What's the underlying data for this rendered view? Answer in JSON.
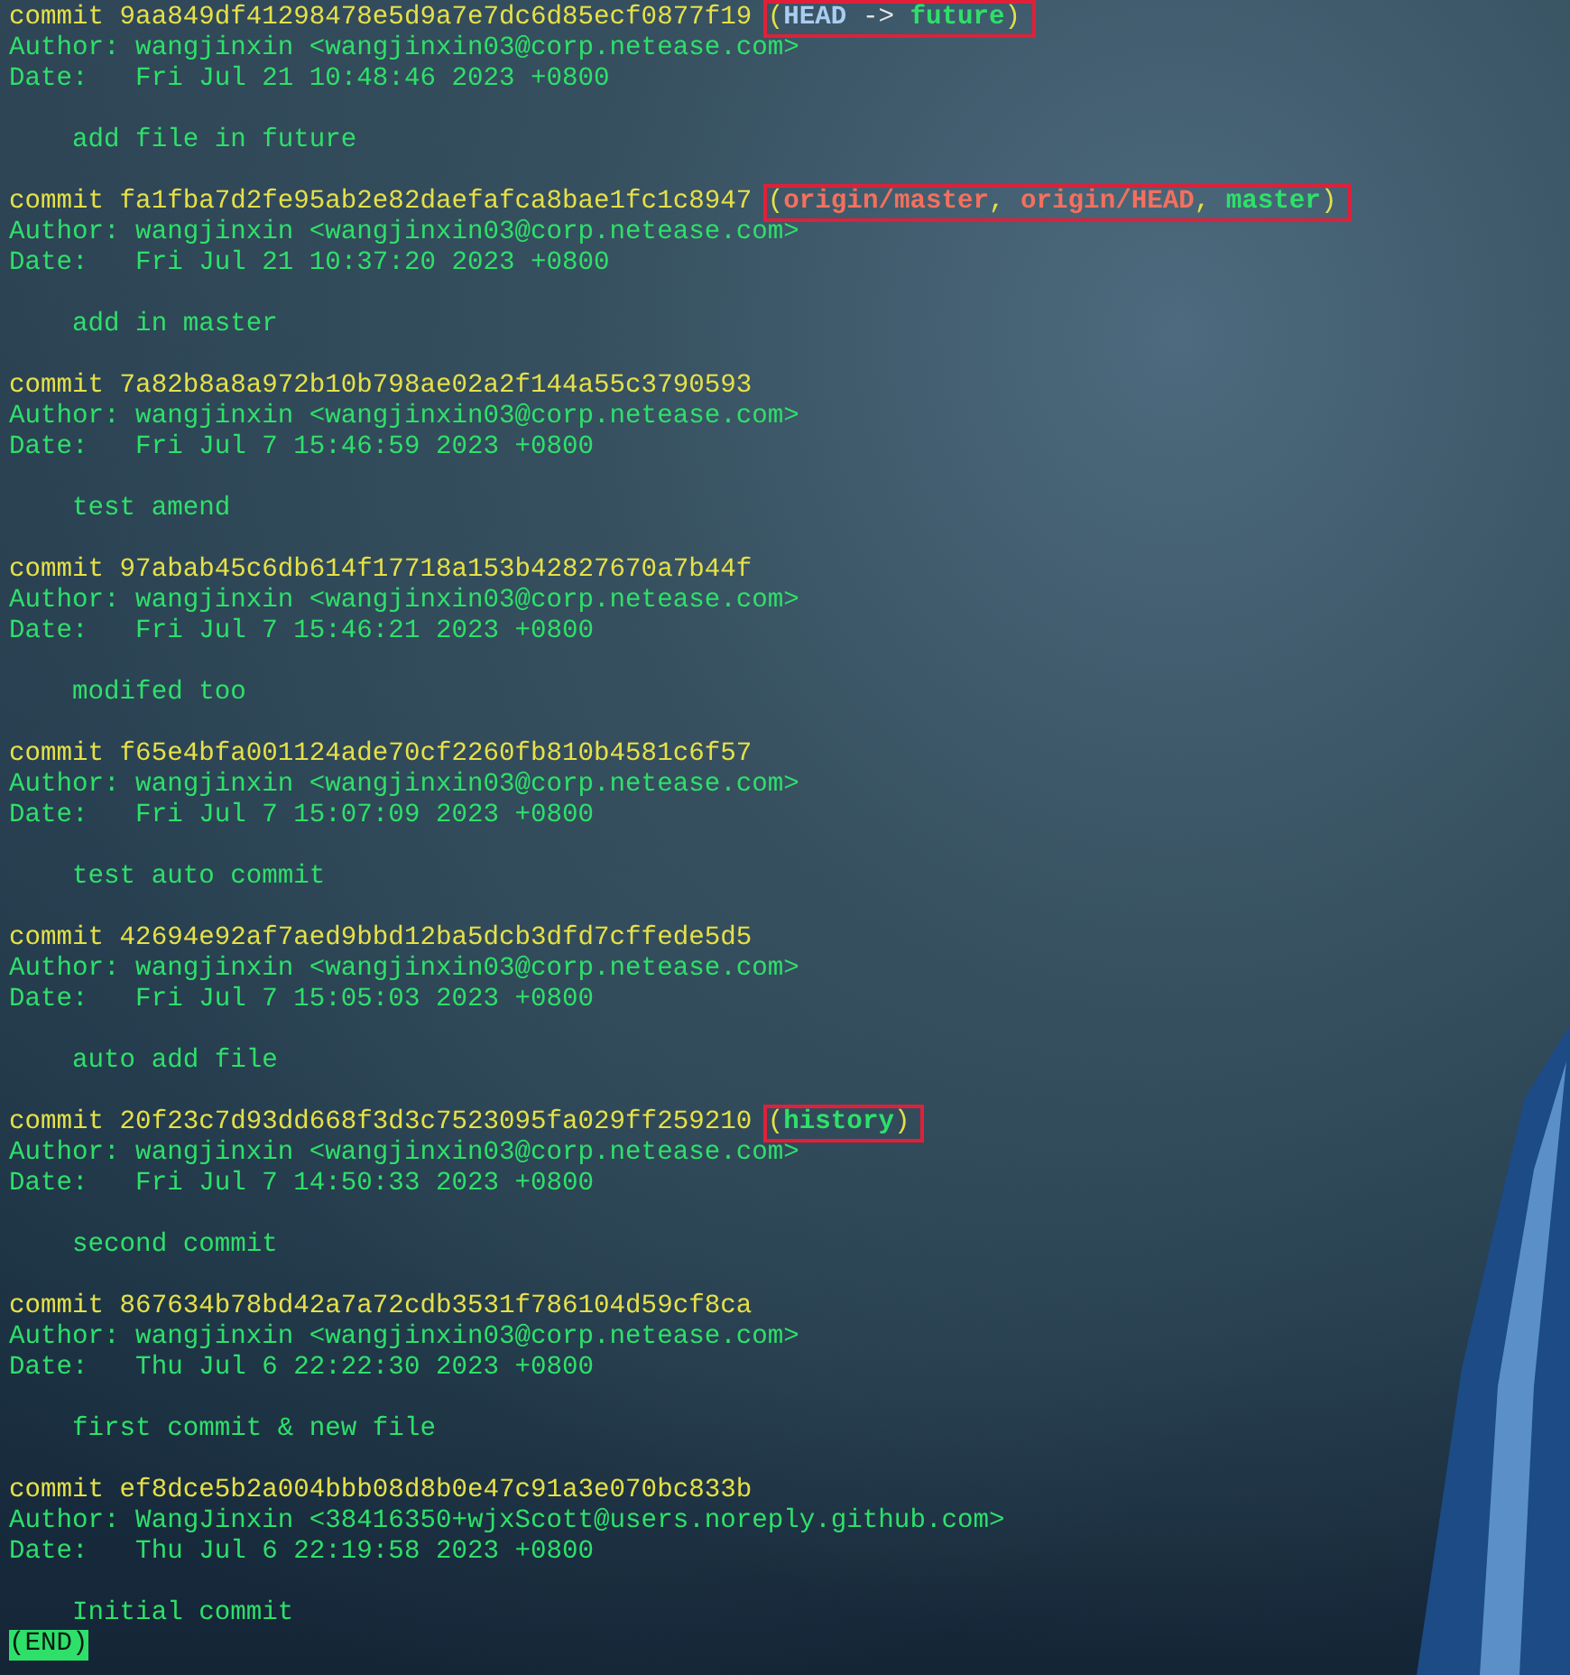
{
  "commits": [
    {
      "label": "commit",
      "hash": "9aa849df41298478e5d9a7e7dc6d85ecf0877f19",
      "highlighted": true,
      "refs": {
        "open": "(",
        "close": ")",
        "items": [
          {
            "kind": "head",
            "name": "HEAD",
            "arrow": "->",
            "target": "future"
          }
        ]
      },
      "author": "Author: wangjinxin <wangjinxin03@corp.netease.com>",
      "date": "Date:   Fri Jul 21 10:48:46 2023 +0800",
      "message": "add file in future"
    },
    {
      "label": "commit",
      "hash": "fa1fba7d2fe95ab2e82daefafca8bae1fc1c8947",
      "highlighted": true,
      "refs": {
        "open": "(",
        "close": ")",
        "items": [
          {
            "kind": "remote",
            "name": "origin/master"
          },
          {
            "kind": "remote",
            "name": "origin/HEAD",
            "sep": ","
          },
          {
            "kind": "local",
            "name": "master",
            "sep": ","
          }
        ]
      },
      "author": "Author: wangjinxin <wangjinxin03@corp.netease.com>",
      "date": "Date:   Fri Jul 21 10:37:20 2023 +0800",
      "message": "add in master"
    },
    {
      "label": "commit",
      "hash": "7a82b8a8a972b10b798ae02a2f144a55c3790593",
      "author": "Author: wangjinxin <wangjinxin03@corp.netease.com>",
      "date": "Date:   Fri Jul 7 15:46:59 2023 +0800",
      "message": "test amend"
    },
    {
      "label": "commit",
      "hash": "97abab45c6db614f17718a153b42827670a7b44f",
      "author": "Author: wangjinxin <wangjinxin03@corp.netease.com>",
      "date": "Date:   Fri Jul 7 15:46:21 2023 +0800",
      "message": "modifed too"
    },
    {
      "label": "commit",
      "hash": "f65e4bfa001124ade70cf2260fb810b4581c6f57",
      "author": "Author: wangjinxin <wangjinxin03@corp.netease.com>",
      "date": "Date:   Fri Jul 7 15:07:09 2023 +0800",
      "message": "test auto commit"
    },
    {
      "label": "commit",
      "hash": "42694e92af7aed9bbd12ba5dcb3dfd7cffede5d5",
      "author": "Author: wangjinxin <wangjinxin03@corp.netease.com>",
      "date": "Date:   Fri Jul 7 15:05:03 2023 +0800",
      "message": "auto add file"
    },
    {
      "label": "commit",
      "hash": "20f23c7d93dd668f3d3c7523095fa029ff259210",
      "highlighted": true,
      "refs": {
        "open": "(",
        "close": ")",
        "items": [
          {
            "kind": "local",
            "name": "history"
          }
        ]
      },
      "author": "Author: wangjinxin <wangjinxin03@corp.netease.com>",
      "date": "Date:   Fri Jul 7 14:50:33 2023 +0800",
      "message": "second commit"
    },
    {
      "label": "commit",
      "hash": "867634b78bd42a7a72cdb3531f786104d59cf8ca",
      "author": "Author: wangjinxin <wangjinxin03@corp.netease.com>",
      "date": "Date:   Thu Jul 6 22:22:30 2023 +0800",
      "message": "first commit & new file"
    },
    {
      "label": "commit",
      "hash": "ef8dce5b2a004bbb08d8b0e47c91a3e070bc833b",
      "author": "Author: WangJinxin <38416350+wjxScott@users.noreply.github.com>",
      "date": "Date:   Thu Jul 6 22:19:58 2023 +0800",
      "message": "Initial commit"
    }
  ],
  "pager_status": "(END)"
}
